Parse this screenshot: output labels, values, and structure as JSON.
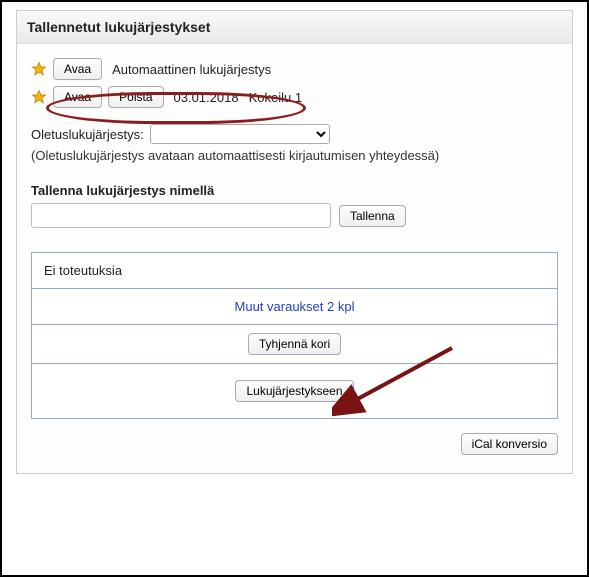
{
  "panel": {
    "title": "Tallennetut lukujärjestykset"
  },
  "schedules": {
    "row1": {
      "open_label": "Avaa",
      "text": "Automaattinen lukujärjestys"
    },
    "row2": {
      "open_label": "Avaa",
      "delete_label": "Poista",
      "date": "03.01.2018",
      "name": "Kokeilu 1"
    }
  },
  "default_schedule": {
    "label": "Oletuslukujärjestys:",
    "hint": "(Oletuslukujärjestys avataan automaattisesti kirjautumisen yhteydessä)"
  },
  "save_section": {
    "label": "Tallenna lukujärjestys nimellä",
    "button": "Tallenna"
  },
  "basket": {
    "no_impl": "Ei toteutuksia",
    "other_reservations": "Muut varaukset 2 kpl",
    "empty": "Tyhjennä kori",
    "to_schedule": "Lukujärjestykseen"
  },
  "bottom": {
    "ical": "iCal konversio"
  }
}
